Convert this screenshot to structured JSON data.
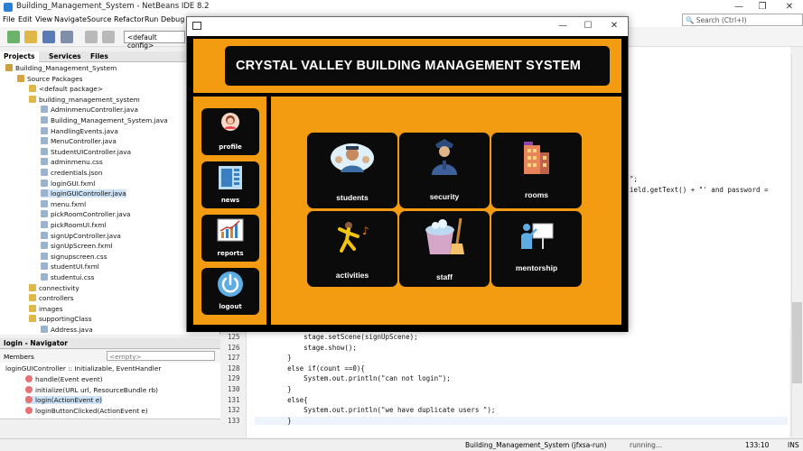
{
  "ide": {
    "title": "Building_Management_System - NetBeans IDE 8.2",
    "menu": [
      "File",
      "Edit",
      "View",
      "Navigate",
      "Source",
      "Refactor",
      "Run",
      "Debug"
    ],
    "config": "<default config>",
    "search_placeholder": "Search (Ctrl+I)",
    "panel_tabs": [
      "Projects",
      "Services",
      "Files"
    ],
    "tree": [
      {
        "label": "Building_Management_System",
        "depth": 0
      },
      {
        "label": "Source Packages",
        "depth": 1
      },
      {
        "label": "<default package>",
        "depth": 2
      },
      {
        "label": "building_management_system",
        "depth": 2
      },
      {
        "label": "AdminmenuController.java",
        "depth": 3
      },
      {
        "label": "Building_Management_System.java",
        "depth": 3
      },
      {
        "label": "HandlingEvents.java",
        "depth": 3
      },
      {
        "label": "MenuController.java",
        "depth": 3
      },
      {
        "label": "StudentUIController.java",
        "depth": 3
      },
      {
        "label": "adminmenu.css",
        "depth": 3
      },
      {
        "label": "credentials.json",
        "depth": 3
      },
      {
        "label": "loginGUI.fxml",
        "depth": 3
      },
      {
        "label": "loginGUIController.java",
        "depth": 3
      },
      {
        "label": "menu.fxml",
        "depth": 3
      },
      {
        "label": "pickRoomController.java",
        "depth": 3
      },
      {
        "label": "pickRoomUI.fxml",
        "depth": 3
      },
      {
        "label": "signUpController.java",
        "depth": 3
      },
      {
        "label": "signUpScreen.fxml",
        "depth": 3
      },
      {
        "label": "signupscreen.css",
        "depth": 3
      },
      {
        "label": "studentUI.fxml",
        "depth": 3
      },
      {
        "label": "studentui.css",
        "depth": 3
      },
      {
        "label": "connectivity",
        "depth": 2
      },
      {
        "label": "controllers",
        "depth": 2
      },
      {
        "label": "images",
        "depth": 2
      },
      {
        "label": "supportingClass",
        "depth": 2
      },
      {
        "label": "Address.java",
        "depth": 3
      }
    ],
    "navigator": {
      "header": "login - Navigator",
      "filter_label": "Members",
      "filter_value": "<empty>",
      "root": "loginGUIController :: Initializable, EventHandler",
      "items": [
        "handle(Event event)",
        "initialize(URL url, ResourceBundle rb)",
        "login(ActionEvent e)",
        "loginButtonClicked(ActionEvent e)"
      ]
    },
    "code_lines": [
      {
        "n": "125",
        "text": "            stage.setScene(signUpScene);"
      },
      {
        "n": "126",
        "text": "            stage.show();"
      },
      {
        "n": "127",
        "text": "        }"
      },
      {
        "n": "128",
        "text": "        else if(count ==0){"
      },
      {
        "n": "129",
        "text": "            System.out.println(\"can not login\");"
      },
      {
        "n": "130",
        "text": "        }"
      },
      {
        "n": "131",
        "text": "        else{"
      },
      {
        "n": "132",
        "text": "            System.out.println(\"we have duplicate users \");"
      },
      {
        "n": "133",
        "text": "        }"
      }
    ],
    "code_fragment_1": "\";",
    "code_fragment_2": "ield.getText() + \"' and password =",
    "status_project": "Building_Management_System (jfxsa-run)",
    "status_running": "running...",
    "status_pos": "133:10",
    "status_mode": "INS"
  },
  "app": {
    "header_title": "CRYSTAL VALLEY BUILDING MANAGEMENT SYSTEM",
    "sidebar": [
      {
        "label": "profile",
        "icon": "profile-avatar-icon"
      },
      {
        "label": "news",
        "icon": "news-icon"
      },
      {
        "label": "reports",
        "icon": "reports-chart-icon"
      },
      {
        "label": "logout",
        "icon": "power-icon"
      }
    ],
    "tiles": [
      {
        "label": "students",
        "icon": "students-icon"
      },
      {
        "label": "security",
        "icon": "security-guard-icon"
      },
      {
        "label": "rooms",
        "icon": "rooms-building-icon"
      },
      {
        "label": "activities",
        "icon": "dancing-person-icon"
      },
      {
        "label": "staff",
        "icon": "cleaning-bucket-icon"
      },
      {
        "label": "mentorship",
        "icon": "presentation-board-icon"
      }
    ],
    "colors": {
      "accent": "#f39c12",
      "panel": "#0b0b0b",
      "frame": "#000000"
    }
  }
}
